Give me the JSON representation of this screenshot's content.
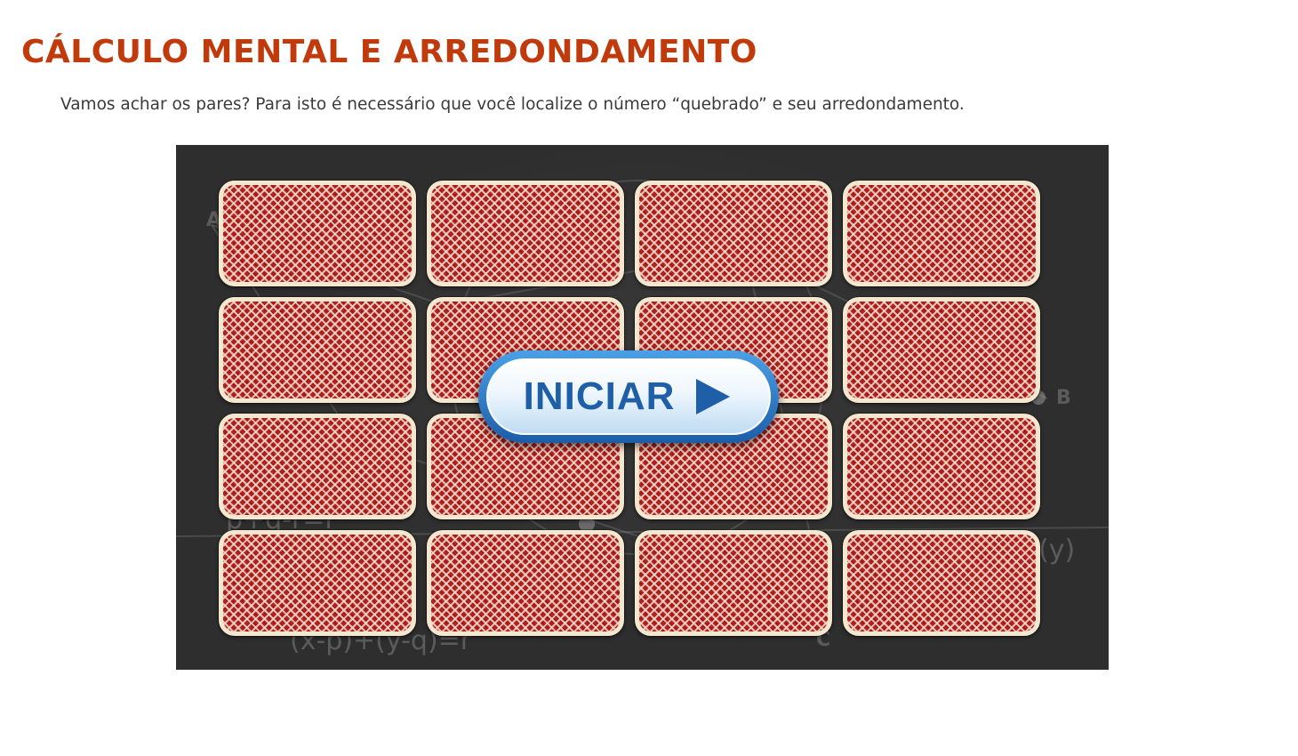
{
  "page": {
    "title": "CÁLCULO MENTAL E ARREDONDAMENTO",
    "intro": "Vamos achar os pares? Para isto é necessário que você localize o número “quebrado” e seu arredondamento."
  },
  "game": {
    "start_button_label": "INICIAR",
    "start_button_icon": "play-arrow-icon",
    "card_back_color": "#b5211f",
    "card_border_color": "#f3e7cf",
    "board_color": "#2e2e2e",
    "background_chalk_text": [
      "A",
      "B",
      "C",
      "p+q-r=r",
      "(x-p)+(y-q)=r",
      "(y)"
    ],
    "card_rows": 4,
    "card_columns": 4,
    "cards": [
      {
        "state": "face-down"
      },
      {
        "state": "face-down"
      },
      {
        "state": "face-down"
      },
      {
        "state": "face-down"
      },
      {
        "state": "face-down"
      },
      {
        "state": "face-down"
      },
      {
        "state": "face-down"
      },
      {
        "state": "face-down"
      },
      {
        "state": "face-down"
      },
      {
        "state": "face-down"
      },
      {
        "state": "face-down"
      },
      {
        "state": "face-down"
      },
      {
        "state": "face-down"
      },
      {
        "state": "face-down"
      },
      {
        "state": "face-down"
      },
      {
        "state": "face-down"
      }
    ]
  }
}
